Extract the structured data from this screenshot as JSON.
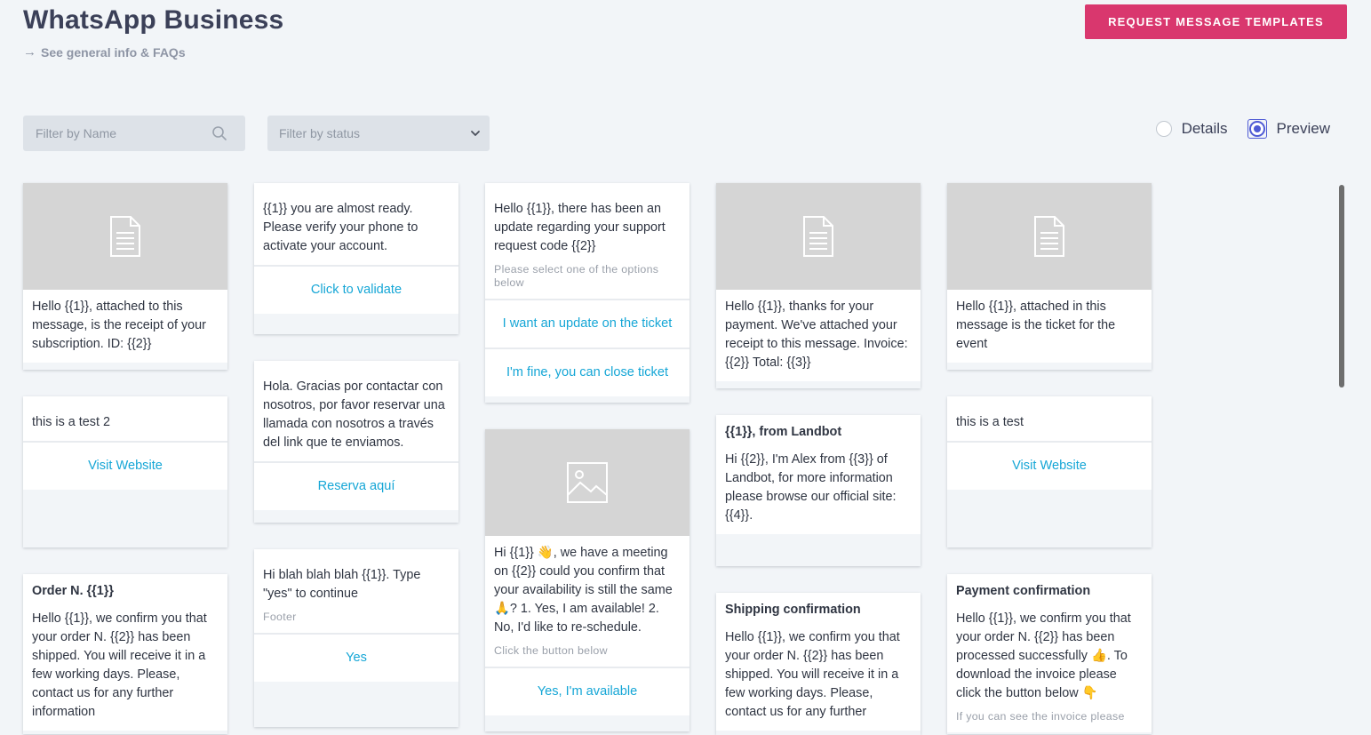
{
  "header": {
    "title": "WhatsApp Business",
    "faq_link": "See general info & FAQs",
    "request_button": "REQUEST MESSAGE TEMPLATES"
  },
  "filters": {
    "name_placeholder": "Filter by Name",
    "status_placeholder": "Filter by status"
  },
  "view_toggle": {
    "details_label": "Details",
    "preview_label": "Preview",
    "selected": "Preview"
  },
  "cards": {
    "c1": {
      "body": "Hello {{1}}, attached to this message, is the receipt of your subscription. ID: {{2}}"
    },
    "c2": {
      "body": "this is a test 2",
      "button": "Visit Website"
    },
    "c3": {
      "header": "Order N. {{1}}",
      "body": "Hello {{1}}, we confirm you that your order N. {{2}} has been shipped. You will receive it in a few working days. Please, contact us for any further information"
    },
    "c4": {
      "body": "{{1}} you are almost ready. Please verify your phone to activate your account.",
      "button": "Click to validate"
    },
    "c5": {
      "body": "Hola. Gracias por contactar con nosotros, por favor reservar una llamada con nosotros a través del link que te enviamos.",
      "button": "Reserva aquí"
    },
    "c6": {
      "body": "Hi blah blah blah {{1}}. Type \"yes\" to continue",
      "footer": "Footer",
      "button": "Yes"
    },
    "c7": {
      "body": "Hello {{1}}, there has been an update regarding your support request code {{2}}",
      "footer": "Please select one of the options below",
      "button1": "I want an update on the ticket",
      "button2": "I'm fine, you can close ticket"
    },
    "c8": {
      "body": "Hi {{1}} 👋, we have a meeting on {{2}} could you confirm that your availability is still the same 🙏? 1. Yes, I am available! 2. No, I'd like to re-schedule.",
      "footer": "Click the button below",
      "button": "Yes, I'm available"
    },
    "c9": {
      "body": "Hello {{1}}, thanks for your payment. We've attached your receipt to this message. Invoice: {{2}} Total: {{3}}"
    },
    "c10": {
      "header": "{{1}}, from Landbot",
      "body": "Hi {{2}}, I'm Alex from {{3}} of Landbot, for more information please browse our official site: {{4}}."
    },
    "c11": {
      "header": "Shipping confirmation",
      "body": "Hello {{1}}, we confirm you that your order N. {{2}} has been shipped. You will receive it in a few working days. Please, contact us for any further"
    },
    "c12": {
      "body": "Hello {{1}}, attached in this message is the ticket for the event"
    },
    "c13": {
      "body": "this is a test",
      "button": "Visit Website"
    },
    "c14": {
      "header": "Payment confirmation",
      "body": "Hello {{1}}, we confirm you that your order N. {{2}} has been processed successfully 👍. To download the invoice please click the button below 👇",
      "footer": "If you can see the invoice please"
    }
  }
}
